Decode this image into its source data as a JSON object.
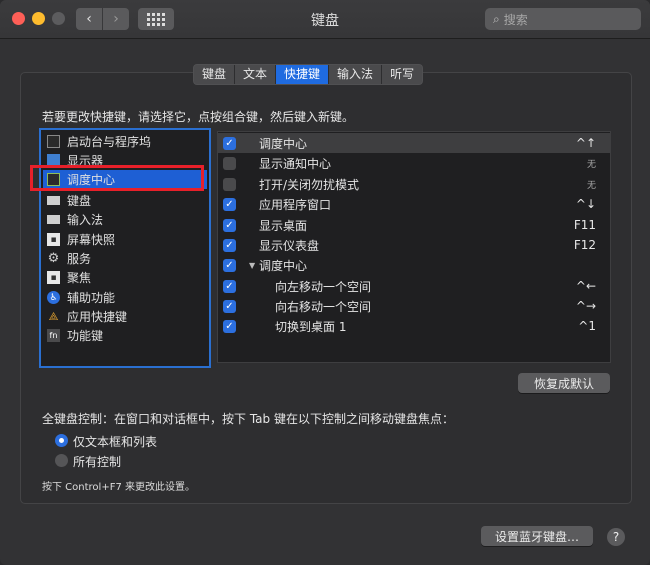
{
  "window": {
    "title": "键盘"
  },
  "titlebar": {
    "search_placeholder": "搜索"
  },
  "tabs": [
    {
      "label": "键盘"
    },
    {
      "label": "文本"
    },
    {
      "label": "快捷键",
      "active": true
    },
    {
      "label": "输入法"
    },
    {
      "label": "听写"
    }
  ],
  "hint": "若要更改快捷键，请选择它，点按组合键，然后键入新键。",
  "categories": [
    {
      "label": "启动台与程序坞",
      "icon": "launchpad-icon"
    },
    {
      "label": "显示器",
      "icon": "display-icon"
    },
    {
      "label": "调度中心",
      "icon": "mission-control-icon",
      "selected": true
    },
    {
      "label": "键盘",
      "icon": "keyboard-icon"
    },
    {
      "label": "输入法",
      "icon": "input-source-icon"
    },
    {
      "label": "屏幕快照",
      "icon": "screenshot-icon"
    },
    {
      "label": "服务",
      "icon": "gear-icon"
    },
    {
      "label": "聚焦",
      "icon": "spotlight-icon"
    },
    {
      "label": "辅助功能",
      "icon": "accessibility-icon"
    },
    {
      "label": "应用快捷键",
      "icon": "app-shortcuts-icon"
    },
    {
      "label": "功能键",
      "icon": "fn-icon"
    }
  ],
  "shortcuts": [
    {
      "label": "调度中心",
      "key": "^↑",
      "checked": true,
      "selected": true,
      "indent": 0
    },
    {
      "label": "显示通知中心",
      "key": "无",
      "checked": false,
      "indent": 0
    },
    {
      "label": "打开/关闭勿扰模式",
      "key": "无",
      "checked": false,
      "indent": 0
    },
    {
      "label": "应用程序窗口",
      "key": "^↓",
      "checked": true,
      "indent": 0
    },
    {
      "label": "显示桌面",
      "key": "F11",
      "checked": true,
      "indent": 0
    },
    {
      "label": "显示仪表盘",
      "key": "F12",
      "checked": true,
      "indent": 0
    },
    {
      "label": "调度中心",
      "key": "",
      "checked": true,
      "indent": 0,
      "group": true
    },
    {
      "label": "向左移动一个空间",
      "key": "^←",
      "checked": true,
      "indent": 1
    },
    {
      "label": "向右移动一个空间",
      "key": "^→",
      "checked": true,
      "indent": 1
    },
    {
      "label": "切换到桌面 1",
      "key": "^1",
      "checked": true,
      "indent": 1
    }
  ],
  "restore_button": "恢复成默认",
  "full_keyboard": {
    "label": "全键盘控制：在窗口和对话框中，按下 Tab 键在以下控制之间移动键盘焦点：",
    "options": [
      {
        "label": "仅文本框和列表",
        "selected": true
      },
      {
        "label": "所有控制",
        "selected": false
      }
    ],
    "note": "按下 Control+F7 来更改此设置。"
  },
  "bluetooth_button": "设置蓝牙键盘…",
  "help_label": "?"
}
